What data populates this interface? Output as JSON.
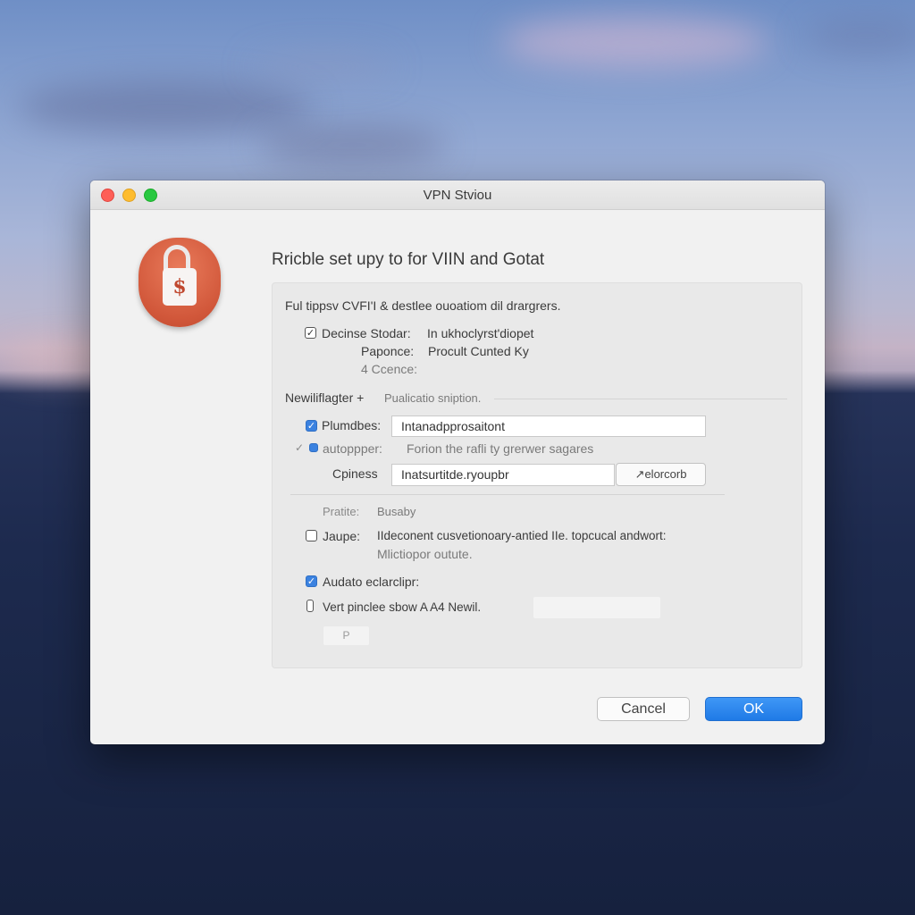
{
  "window": {
    "title": "VPN Stviou"
  },
  "dialog": {
    "heading": "Rricble set upy to for VIIN and Gotat"
  },
  "panel": {
    "intro": "Ful tippsv  CVFI'I & destlee ouoatiom dil drargrers.",
    "decrypt_row": {
      "checked": true,
      "label": "Decinse Stodar:",
      "value": "In ukhoclyrst'diopet"
    },
    "paponce": {
      "label": "Paponce:",
      "value": "Procult Cunted Ky"
    },
    "ccence": {
      "label": "4 Ccence:"
    },
    "section_title": "Newiliflagter +",
    "section_subtitle": "Pualicatio sniption.",
    "plumdbes": {
      "checked": true,
      "label": "Plumdbes:",
      "value": "Intanadpprosaitont"
    },
    "autopper": {
      "label": "autoppper:",
      "text": "Forion the rafli ty grerwer sagares"
    },
    "cpiness": {
      "label": "Cpiness",
      "value": "Inatsurtitde.ryoupbr",
      "button": "↗elorcorb"
    },
    "pratite": {
      "label": "Pratite:",
      "value": "Busaby"
    },
    "jaupe": {
      "checked": false,
      "label": "Jaupe:",
      "text": "IIdeconent cusvetionoary-antied IIe. topcucal andwort:",
      "text2": "Mlictiopor outute."
    },
    "audato": {
      "checked": true,
      "label": "Audato eclarclipr:"
    },
    "vert": {
      "label": "Vert pinclee sbow A A4 Newil."
    },
    "small_button": "P"
  },
  "buttons": {
    "cancel": "Cancel",
    "ok": "OK"
  },
  "colors": {
    "accent": "#1f7ae6",
    "lock_icon": "#d1573a",
    "close": "#fe5f57",
    "minimize": "#febc2e",
    "maximize": "#28c840"
  },
  "icons": [
    "lock-icon",
    "dollar-icon",
    "checkbox-icon",
    "close-icon",
    "minimize-icon",
    "maximize-icon"
  ]
}
